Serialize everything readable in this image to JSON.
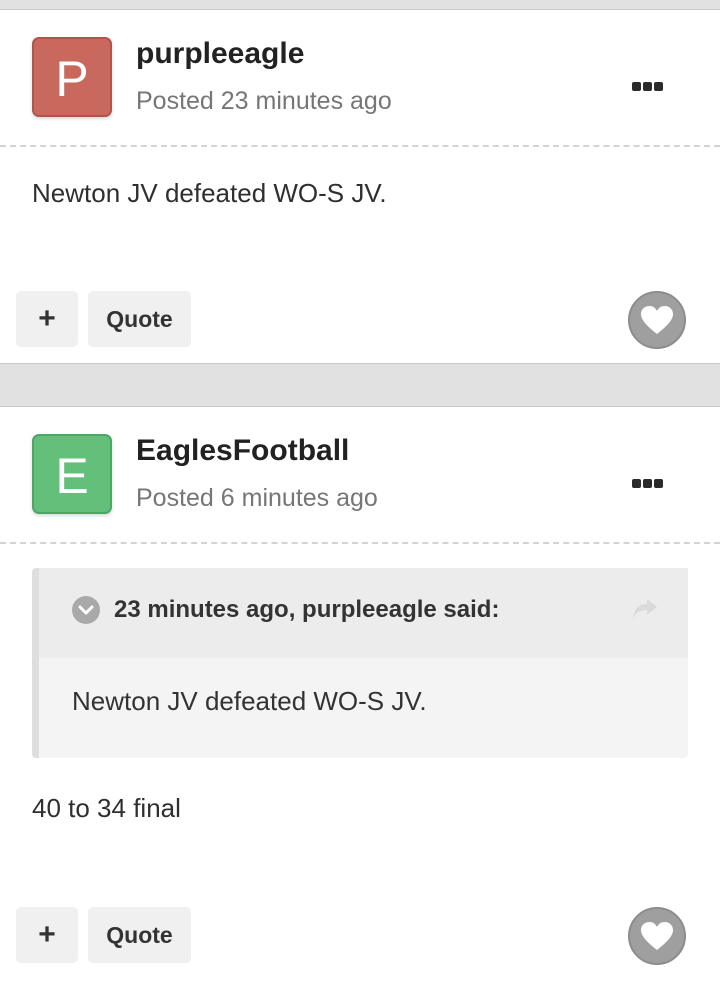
{
  "posts": [
    {
      "avatar_letter": "P",
      "avatar_color": "#c9695e",
      "username": "purpleeagle",
      "posted": "Posted 23 minutes ago",
      "content": "Newton JV defeated WO-S JV.",
      "plus_label": "+",
      "quote_label": "Quote",
      "menu_icon": "more-dots-icon",
      "like_icon": "heart-icon"
    },
    {
      "avatar_letter": "E",
      "avatar_color": "#62c07a",
      "username": "EaglesFootball",
      "posted": "Posted 6 minutes ago",
      "quote": {
        "citation": "23 minutes ago, purpleeagle said:",
        "text": "Newton JV defeated WO-S JV.",
        "toggle_icon": "chevron-down-circle-icon",
        "share_icon": "share-arrow-icon"
      },
      "content": "40 to 34 final",
      "plus_label": "+",
      "quote_label": "Quote",
      "menu_icon": "more-dots-icon",
      "like_icon": "heart-icon"
    }
  ]
}
